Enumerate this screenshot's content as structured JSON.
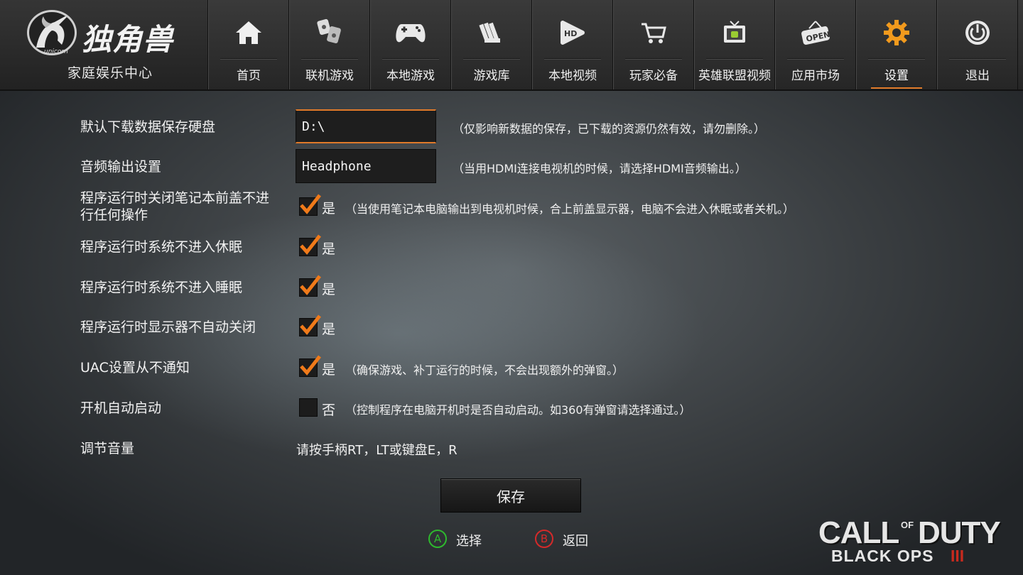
{
  "app": {
    "title": "独角兽",
    "subtitle": "家庭娱乐中心",
    "logo_badge": "unicorn"
  },
  "nav": [
    {
      "label": "首页",
      "icon": "home-icon",
      "active": false
    },
    {
      "label": "联机游戏",
      "icon": "online-games-icon",
      "active": false
    },
    {
      "label": "本地游戏",
      "icon": "gamepad-icon",
      "active": false
    },
    {
      "label": "游戏库",
      "icon": "game-library-icon",
      "active": false
    },
    {
      "label": "本地视频",
      "icon": "hd-video-icon",
      "active": false
    },
    {
      "label": "玩家必备",
      "icon": "cart-icon",
      "active": false
    },
    {
      "label": "英雄联盟视频",
      "icon": "tv-icon",
      "active": false
    },
    {
      "label": "应用市场",
      "icon": "open-sign-icon",
      "active": false
    },
    {
      "label": "设置",
      "icon": "gear-icon",
      "active": true
    },
    {
      "label": "退出",
      "icon": "power-icon",
      "active": false
    }
  ],
  "settings": {
    "download_disk": {
      "label": "默认下载数据保存硬盘",
      "value": "D:\\",
      "hint": "（仅影响新数据的保存，已下载的资源仍然有效，请勿删除。）"
    },
    "audio_output": {
      "label": "音频输出设置",
      "value": "Headphone",
      "hint": "（当用HDMI连接电视机的时候，请选择HDMI音频输出。）"
    },
    "lid_close": {
      "label_line1": "程序运行时关闭笔记本前盖不进",
      "label_line2": "行任何操作",
      "checked": true,
      "state_label": "是",
      "hint": "（当使用笔记本电脑输出到电视机时候，合上前盖显示器，电脑不会进入休眠或者关机。）"
    },
    "no_hibernate": {
      "label": "程序运行时系统不进入休眠",
      "checked": true,
      "state_label": "是"
    },
    "no_sleep": {
      "label": "程序运行时系统不进入睡眠",
      "checked": true,
      "state_label": "是"
    },
    "display_on": {
      "label": "程序运行时显示器不自动关闭",
      "checked": true,
      "state_label": "是"
    },
    "uac": {
      "label": "UAC设置从不通知",
      "checked": true,
      "state_label": "是",
      "hint": "（确保游戏、补丁运行的时候，不会出现额外的弹窗。）"
    },
    "autostart": {
      "label": "开机自动启动",
      "checked": false,
      "state_label": "否",
      "hint": "（控制程序在电脑开机时是否自动启动。如360有弹窗请选择通过。）"
    },
    "volume": {
      "label": "调节音量",
      "value": "请按手柄RT，LT或键盘E，R"
    }
  },
  "actions": {
    "save_label": "保存",
    "select_key": "A",
    "select_label": "选择",
    "back_key": "B",
    "back_label": "返回"
  },
  "branding": {
    "line1": "CALL",
    "of": "OF",
    "line1b": "DUTY",
    "line2": "BLACK OPS",
    "numeral": "III"
  },
  "colors": {
    "accent": "#e07a2a",
    "select_green": "#2eb82e",
    "back_red": "#d42a2a"
  }
}
